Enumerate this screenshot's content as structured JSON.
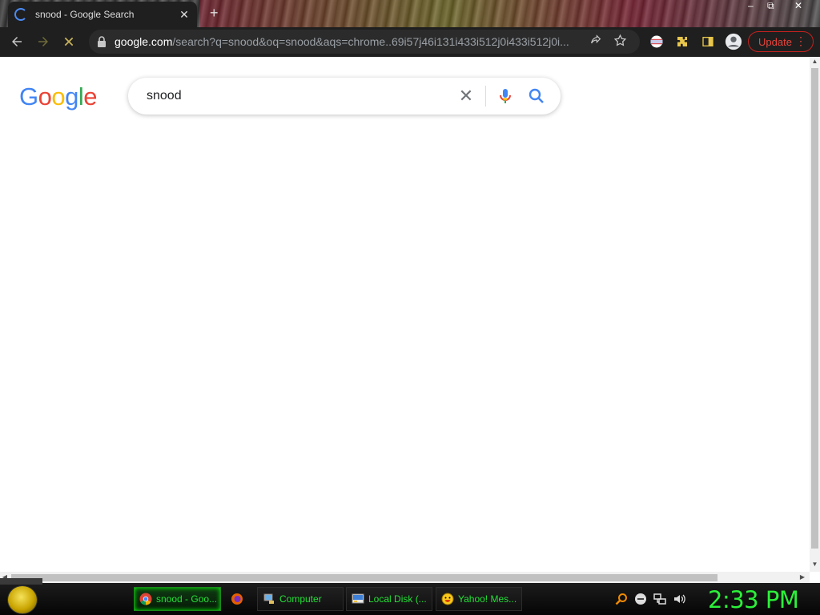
{
  "browser": {
    "tab": {
      "title": "snood - Google Search",
      "close": "✕"
    },
    "new_tab": "+",
    "window_controls": {
      "minimize": "–",
      "maximize": "⧉",
      "close": "✕"
    },
    "address": {
      "host": "google.com",
      "path": "/search?q=snood&oq=snood&aqs=chrome..69i57j46i131i433i512j0i433i512j0i..."
    },
    "update_label": "Update",
    "icons": [
      "back-icon",
      "forward-icon",
      "stop-icon",
      "lock-icon",
      "share-icon",
      "star-icon",
      "profile-flag-icon",
      "extensions-icon",
      "side-panel-icon",
      "account-icon",
      "menu-icon"
    ]
  },
  "google": {
    "logo": {
      "letters": [
        "G",
        "o",
        "o",
        "g",
        "l",
        "e"
      ],
      "colors": [
        "#4285F4",
        "#EA4335",
        "#FBBC05",
        "#4285F4",
        "#34A853",
        "#EA4335"
      ]
    },
    "search": {
      "query": "snood"
    }
  },
  "taskbar": {
    "items": [
      {
        "label": "snood - Goo...",
        "icon": "chrome-icon",
        "active": true
      },
      {
        "label": "",
        "icon": "firefox-icon",
        "active": false
      },
      {
        "label": "Computer",
        "icon": "computer-icon",
        "active": false
      },
      {
        "label": "Local Disk (...",
        "icon": "local-disk-icon",
        "active": false
      },
      {
        "label": "Yahoo! Mes...",
        "icon": "yahoo-messenger-icon",
        "active": false
      }
    ],
    "tray_icons": [
      "search-icon",
      "minus-circle-icon",
      "network-icon",
      "volume-icon"
    ],
    "clock": "2:33 PM",
    "accent": "#24e036"
  }
}
